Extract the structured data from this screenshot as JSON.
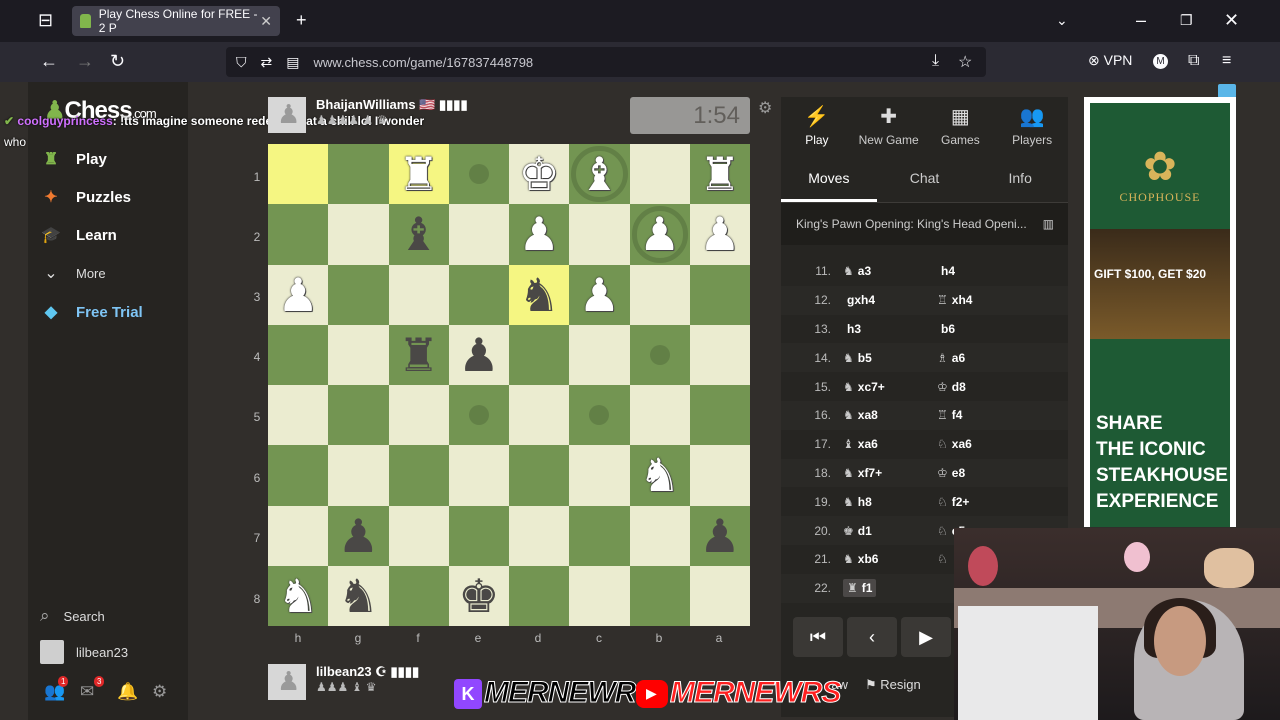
{
  "browser": {
    "tab_title": "Play Chess Online for FREE - 2 P",
    "url": "www.chess.com/game/167837448798",
    "vpn_label": "VPN",
    "profile_initial": "M"
  },
  "sidebar": {
    "logo_text": "Chess",
    "logo_suffix": ".com",
    "items": [
      {
        "label": "Play"
      },
      {
        "label": "Puzzles"
      },
      {
        "label": "Learn"
      },
      {
        "label": "More"
      },
      {
        "label": "Free Trial"
      }
    ],
    "search_label": "Search",
    "username": "lilbean23",
    "friend_badge": "1",
    "mail_badge": "3"
  },
  "chat_overlay": {
    "username": "coolguyprincess",
    "message": ": !tts imagine someone redeems eat a chili lol I wonder",
    "next_line": "who"
  },
  "top_player": {
    "name": "BhaijanWilliams 🇺🇸 ▮▮▮▮",
    "captured": "♟♟♟♟ ♟ ♛"
  },
  "bottom_player": {
    "name": "lilbean23 ☪ ▮▮▮▮",
    "captured": "♟♟♟ ♝ ♛"
  },
  "clock": "1:54",
  "board": {
    "ranks": [
      "1",
      "2",
      "3",
      "4",
      "5",
      "6",
      "7",
      "8"
    ],
    "files": [
      "h",
      "g",
      "f",
      "e",
      "d",
      "c",
      "b",
      "a"
    ]
  },
  "panel": {
    "top_tabs": [
      {
        "label": "Play",
        "icon": "⚡"
      },
      {
        "label": "New Game",
        "icon": "✚"
      },
      {
        "label": "Games",
        "icon": "▦"
      },
      {
        "label": "Players",
        "icon": "👥"
      }
    ],
    "sub_tabs": [
      "Moves",
      "Chat",
      "Info"
    ],
    "opening": "King's Pawn Opening: King's Head Openi...",
    "moves": [
      {
        "n": "11.",
        "wg": "♞",
        "w": "a3",
        "bg": "",
        "b": "h4"
      },
      {
        "n": "12.",
        "wg": "",
        "w": "gxh4",
        "bg": "♖",
        "b": "xh4"
      },
      {
        "n": "13.",
        "wg": "",
        "w": "h3",
        "bg": "",
        "b": "b6"
      },
      {
        "n": "14.",
        "wg": "♞",
        "w": "b5",
        "bg": "♗",
        "b": "a6"
      },
      {
        "n": "15.",
        "wg": "♞",
        "w": "xc7+",
        "bg": "♔",
        "b": "d8"
      },
      {
        "n": "16.",
        "wg": "♞",
        "w": "xa8",
        "bg": "♖",
        "b": "f4"
      },
      {
        "n": "17.",
        "wg": "♝",
        "w": "xa6",
        "bg": "♘",
        "b": "xa6"
      },
      {
        "n": "18.",
        "wg": "♞",
        "w": "xf7+",
        "bg": "♔",
        "b": "e8"
      },
      {
        "n": "19.",
        "wg": "♞",
        "w": "h8",
        "bg": "♘",
        "b": "f2+"
      },
      {
        "n": "20.",
        "wg": "♚",
        "w": "d1",
        "bg": "♘",
        "b": "c5"
      },
      {
        "n": "21.",
        "wg": "♞",
        "w": "xb6",
        "bg": "♘",
        "b": ""
      },
      {
        "n": "22.",
        "wg": "♜",
        "w": "f1",
        "bg": "",
        "b": ""
      }
    ],
    "draw_label": "raw",
    "resign_label": "Resign"
  },
  "ad": {
    "brand": "CHOPHOUSE",
    "gift_line": "GIFT $100, GET $20",
    "share_lines": [
      "SHARE",
      "THE ICONIC",
      "STEAKHOUSE",
      "EXPERIENCE"
    ]
  },
  "banner": {
    "left_text": "MERNEWR",
    "right_text": "MERNEWRS",
    "kick_letter": "K"
  }
}
